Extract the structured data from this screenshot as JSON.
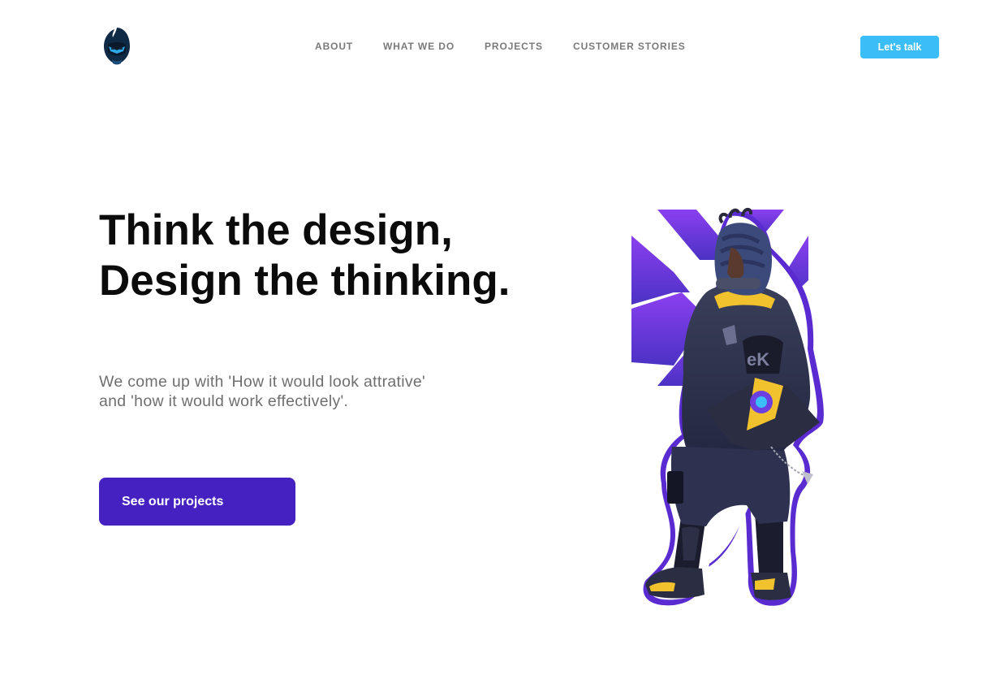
{
  "header": {
    "logo_icon": "hooded-ninja-logo-icon",
    "nav": [
      {
        "label": "ABOUT"
      },
      {
        "label": "WHAT WE DO"
      },
      {
        "label": "PROJECTS"
      },
      {
        "label": "CUSTOMER STORIES"
      }
    ],
    "cta_label": "Let's talk"
  },
  "hero": {
    "title_line1": "Think the design,",
    "title_line2": "Design the thinking.",
    "subtitle_line1": "We come up with 'How it would look attrative'",
    "subtitle_line2": "and 'how it would work effectively'.",
    "button_label": "See our projects",
    "illustration": "hooded-character-illustration"
  },
  "colors": {
    "accent_blue": "#3bbdf7",
    "accent_purple": "#4421c0",
    "heading": "#0b0b0b",
    "body_text": "#6f6f6f",
    "nav_text": "#7a7a7a"
  }
}
